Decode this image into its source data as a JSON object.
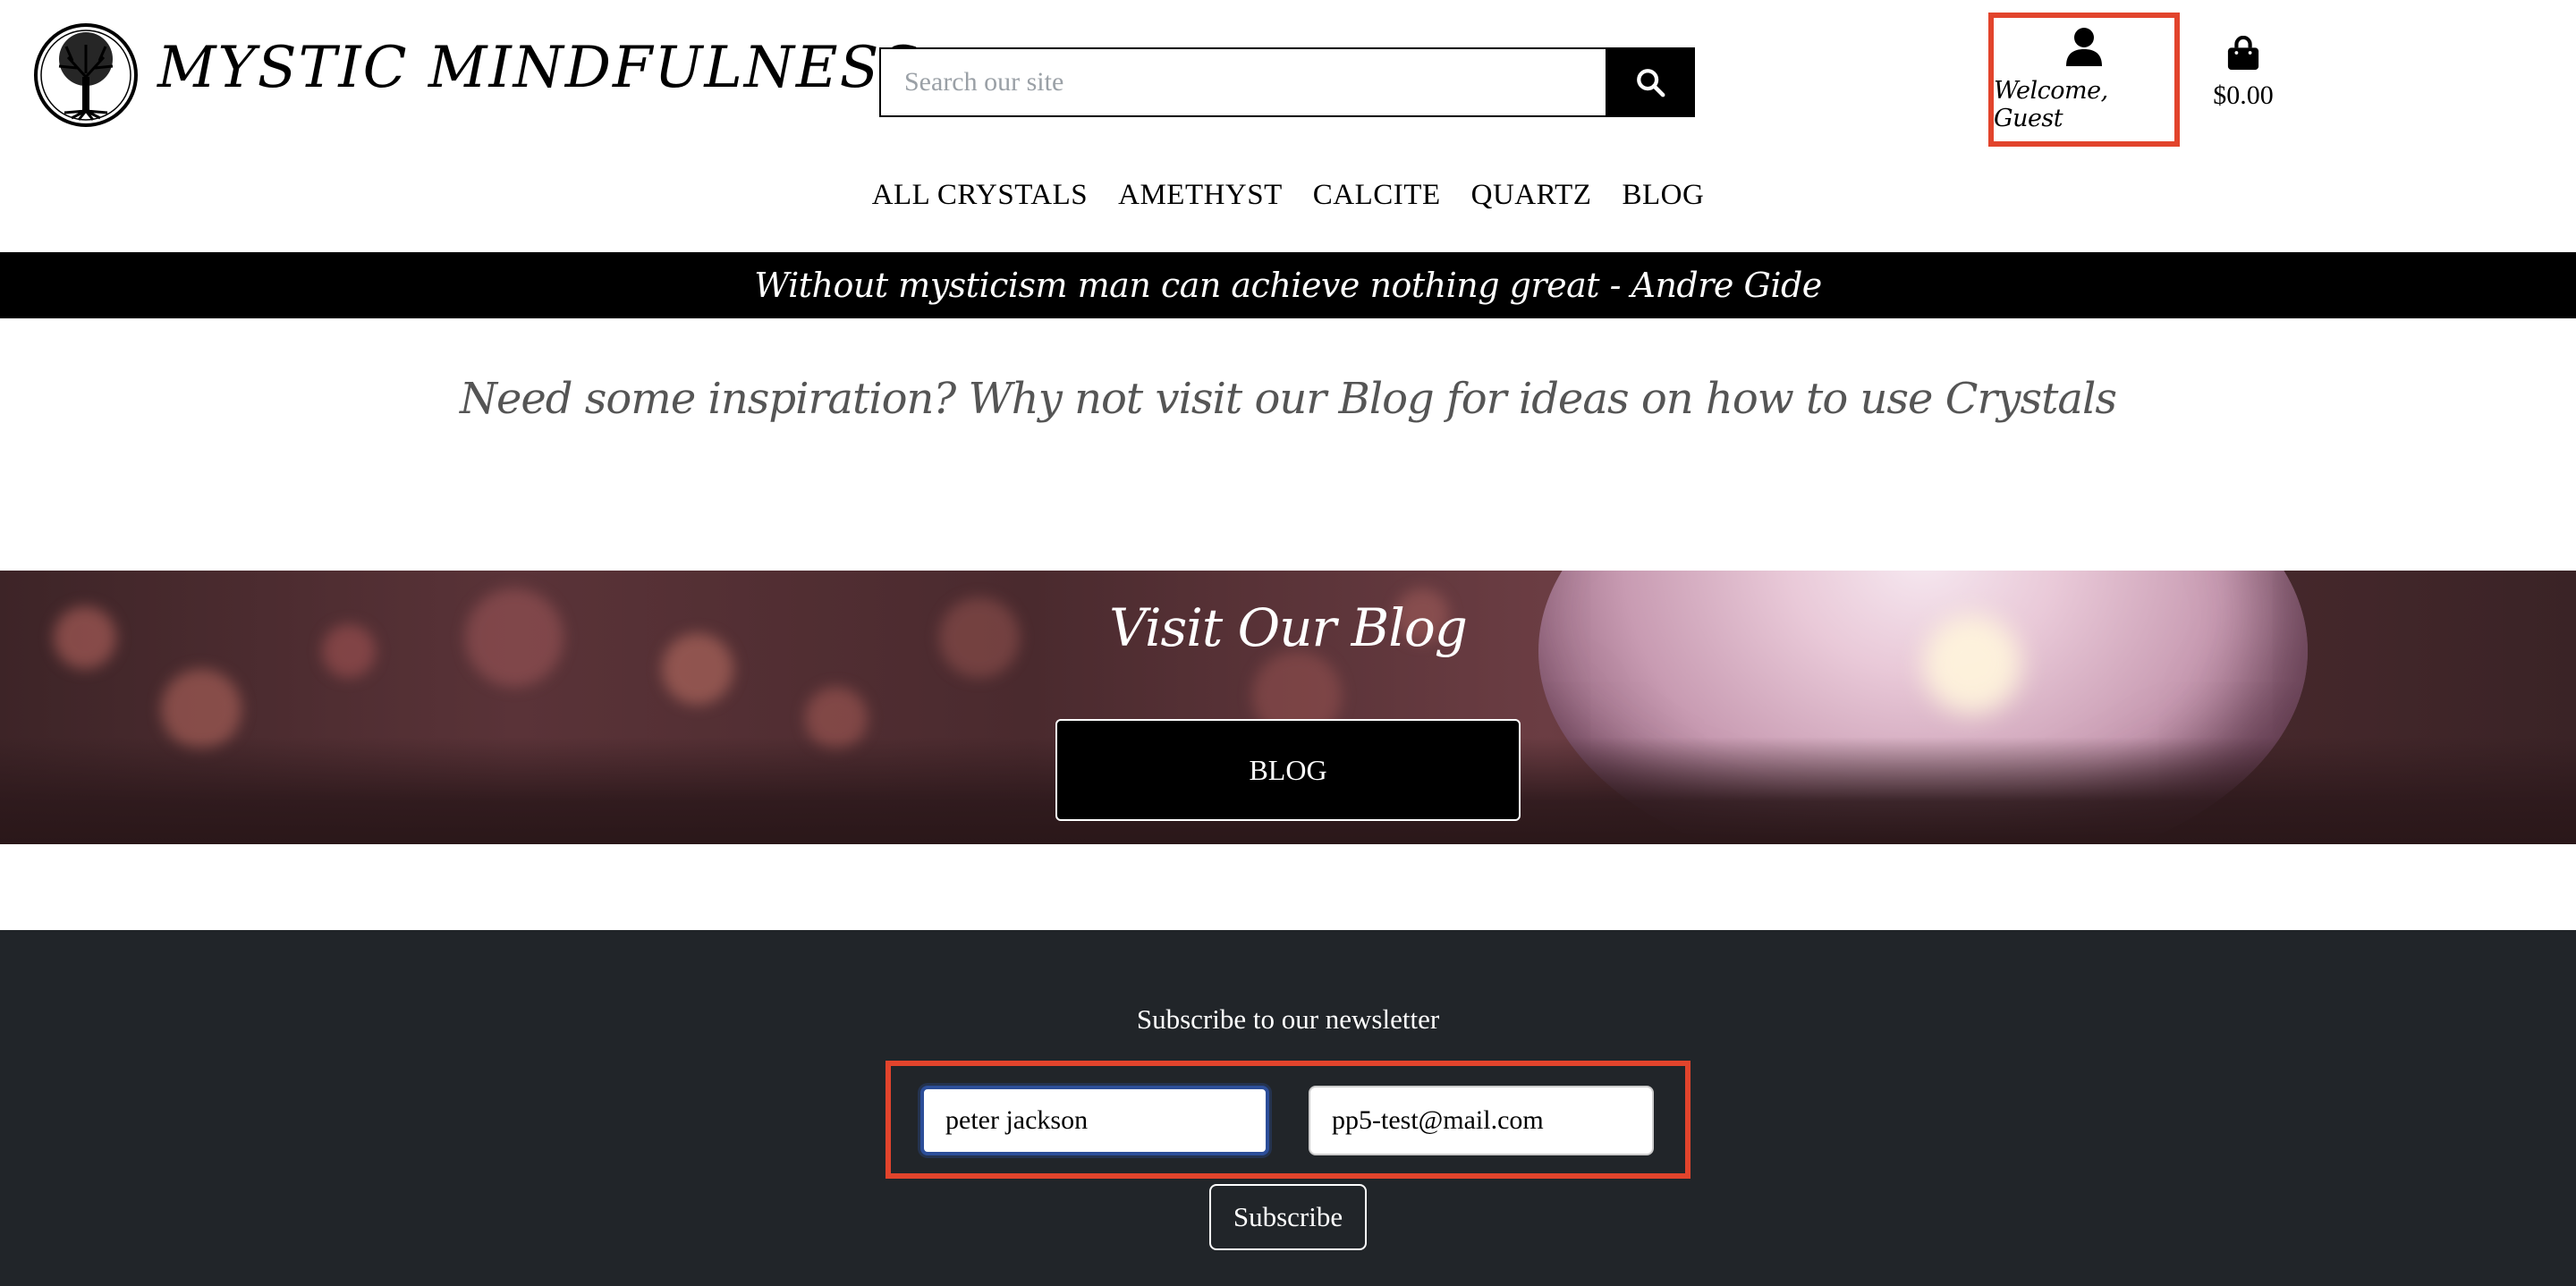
{
  "header": {
    "brand": "MYSTIC MINDFULNESS",
    "search": {
      "placeholder": "Search our site",
      "value": ""
    },
    "account_label": "Welcome, Guest",
    "cart_total": "$0.00"
  },
  "nav": {
    "items": [
      {
        "label": "ALL CRYSTALS"
      },
      {
        "label": "AMETHYST"
      },
      {
        "label": "CALCITE"
      },
      {
        "label": "QUARTZ"
      },
      {
        "label": "BLOG"
      }
    ]
  },
  "quote": "Without mysticism man can achieve nothing great - Andre Gide",
  "inspiration": "Need some inspiration? Why not visit our Blog for ideas on how to use Crystals",
  "banner": {
    "title": "Visit Our Blog",
    "button_label": "BLOG"
  },
  "footer": {
    "newsletter_title": "Subscribe to our newsletter",
    "name_value": "peter jackson",
    "email_value": "pp5-test@mail.com",
    "subscribe_label": "Subscribe"
  },
  "colors": {
    "highlight": "#e2442c",
    "footer_bg": "#212529",
    "focus_ring": "#2c4e99"
  }
}
